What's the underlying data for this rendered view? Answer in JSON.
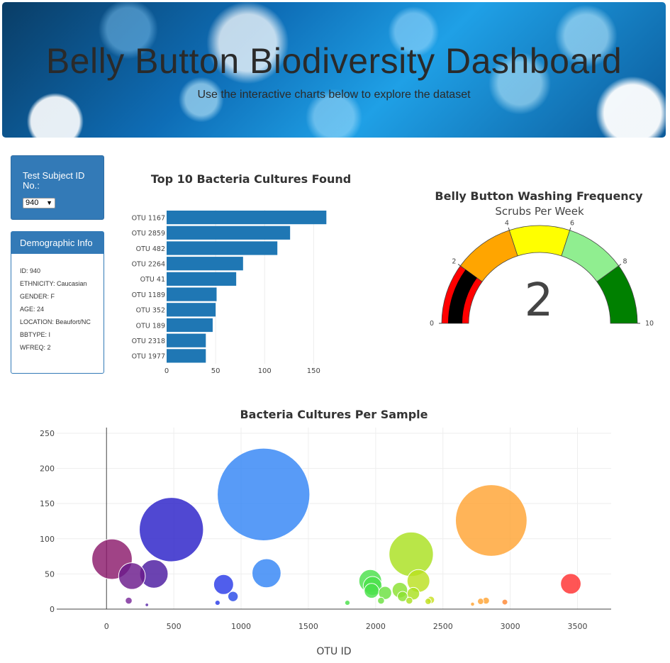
{
  "header": {
    "title": "Belly Button Biodiversity Dashboard",
    "subtitle": "Use the interactive charts below to explore the dataset"
  },
  "subject": {
    "label": "Test Subject ID No.:",
    "selected": "940"
  },
  "demographics": {
    "title": "Demographic Info",
    "rows": [
      "ID: 940",
      "ETHNICITY: Caucasian",
      "GENDER: F",
      "AGE: 24",
      "LOCATION: Beaufort/NC",
      "BBTYPE: I",
      "WFREQ: 2"
    ]
  },
  "colors": {
    "bar": "#1f77b4",
    "panel": "#337ab7"
  },
  "chart_data": [
    {
      "type": "bar",
      "orientation": "horizontal",
      "title": "Top 10 Bacteria Cultures Found",
      "categories": [
        "OTU 1167",
        "OTU 2859",
        "OTU 482",
        "OTU 2264",
        "OTU 41",
        "OTU 1189",
        "OTU 352",
        "OTU 189",
        "OTU 2318",
        "OTU 1977"
      ],
      "values": [
        163,
        126,
        113,
        78,
        71,
        51,
        50,
        47,
        40,
        40
      ],
      "xticks": [
        0,
        50,
        100,
        150
      ],
      "xlim": [
        0,
        170
      ]
    },
    {
      "type": "gauge",
      "title": "Belly Button Washing Frequency",
      "subtitle": "Scrubs Per Week",
      "value": 2,
      "range": [
        0,
        10
      ],
      "ticks": [
        0,
        2,
        4,
        6,
        8,
        10
      ],
      "steps": [
        {
          "range": [
            0,
            2
          ],
          "color": "#ff0000"
        },
        {
          "range": [
            2,
            4
          ],
          "color": "#ffa500"
        },
        {
          "range": [
            4,
            6
          ],
          "color": "#ffff00"
        },
        {
          "range": [
            6,
            8
          ],
          "color": "#90ee90"
        },
        {
          "range": [
            8,
            10
          ],
          "color": "#008000"
        }
      ],
      "bar_color": "#000000"
    },
    {
      "type": "scatter",
      "title": "Bacteria Cultures Per Sample",
      "xlabel": "OTU ID",
      "xticks": [
        0,
        500,
        1000,
        1500,
        2000,
        2500,
        3000,
        3500
      ],
      "yticks": [
        0,
        50,
        100,
        150,
        200,
        250
      ],
      "xlim": [
        -370,
        3750
      ],
      "ylim": [
        0,
        258
      ],
      "points": [
        {
          "x": 41,
          "y": 71,
          "color": "#8b1a6b"
        },
        {
          "x": 189,
          "y": 47,
          "color": "#6a1a8b"
        },
        {
          "x": 352,
          "y": 50,
          "color": "#4a1aa0"
        },
        {
          "x": 482,
          "y": 113,
          "color": "#2a20c8"
        },
        {
          "x": 870,
          "y": 35,
          "color": "#2a3ae8"
        },
        {
          "x": 940,
          "y": 18,
          "color": "#2a4ae8"
        },
        {
          "x": 1167,
          "y": 163,
          "color": "#3385f5"
        },
        {
          "x": 1189,
          "y": 51,
          "color": "#3385f5"
        },
        {
          "x": 165,
          "y": 12,
          "color": "#7a2a9a"
        },
        {
          "x": 300,
          "y": 6,
          "color": "#5a2aa8"
        },
        {
          "x": 825,
          "y": 9,
          "color": "#2a3ae8"
        },
        {
          "x": 1960,
          "y": 40,
          "color": "#4ae04a"
        },
        {
          "x": 1977,
          "y": 33,
          "color": "#4ae04a"
        },
        {
          "x": 1970,
          "y": 26,
          "color": "#4ae04a"
        },
        {
          "x": 2070,
          "y": 23,
          "color": "#6ae040"
        },
        {
          "x": 2040,
          "y": 12,
          "color": "#6ae040"
        },
        {
          "x": 2180,
          "y": 27,
          "color": "#8ae030"
        },
        {
          "x": 2200,
          "y": 18,
          "color": "#8ae030"
        },
        {
          "x": 2264,
          "y": 78,
          "color": "#aae020"
        },
        {
          "x": 2318,
          "y": 40,
          "color": "#bbe020"
        },
        {
          "x": 2280,
          "y": 22,
          "color": "#aae020"
        },
        {
          "x": 2250,
          "y": 12,
          "color": "#aae020"
        },
        {
          "x": 1790,
          "y": 9,
          "color": "#4ae04a"
        },
        {
          "x": 2390,
          "y": 11,
          "color": "#c0e020"
        },
        {
          "x": 2410,
          "y": 13,
          "color": "#c8e020"
        },
        {
          "x": 2859,
          "y": 126,
          "color": "#ffa333"
        },
        {
          "x": 2720,
          "y": 7,
          "color": "#ffa333"
        },
        {
          "x": 2780,
          "y": 11,
          "color": "#ffa333"
        },
        {
          "x": 2820,
          "y": 12,
          "color": "#ffa333"
        },
        {
          "x": 2960,
          "y": 10,
          "color": "#ff8833"
        },
        {
          "x": 3450,
          "y": 36,
          "color": "#ff3030"
        }
      ]
    }
  ]
}
